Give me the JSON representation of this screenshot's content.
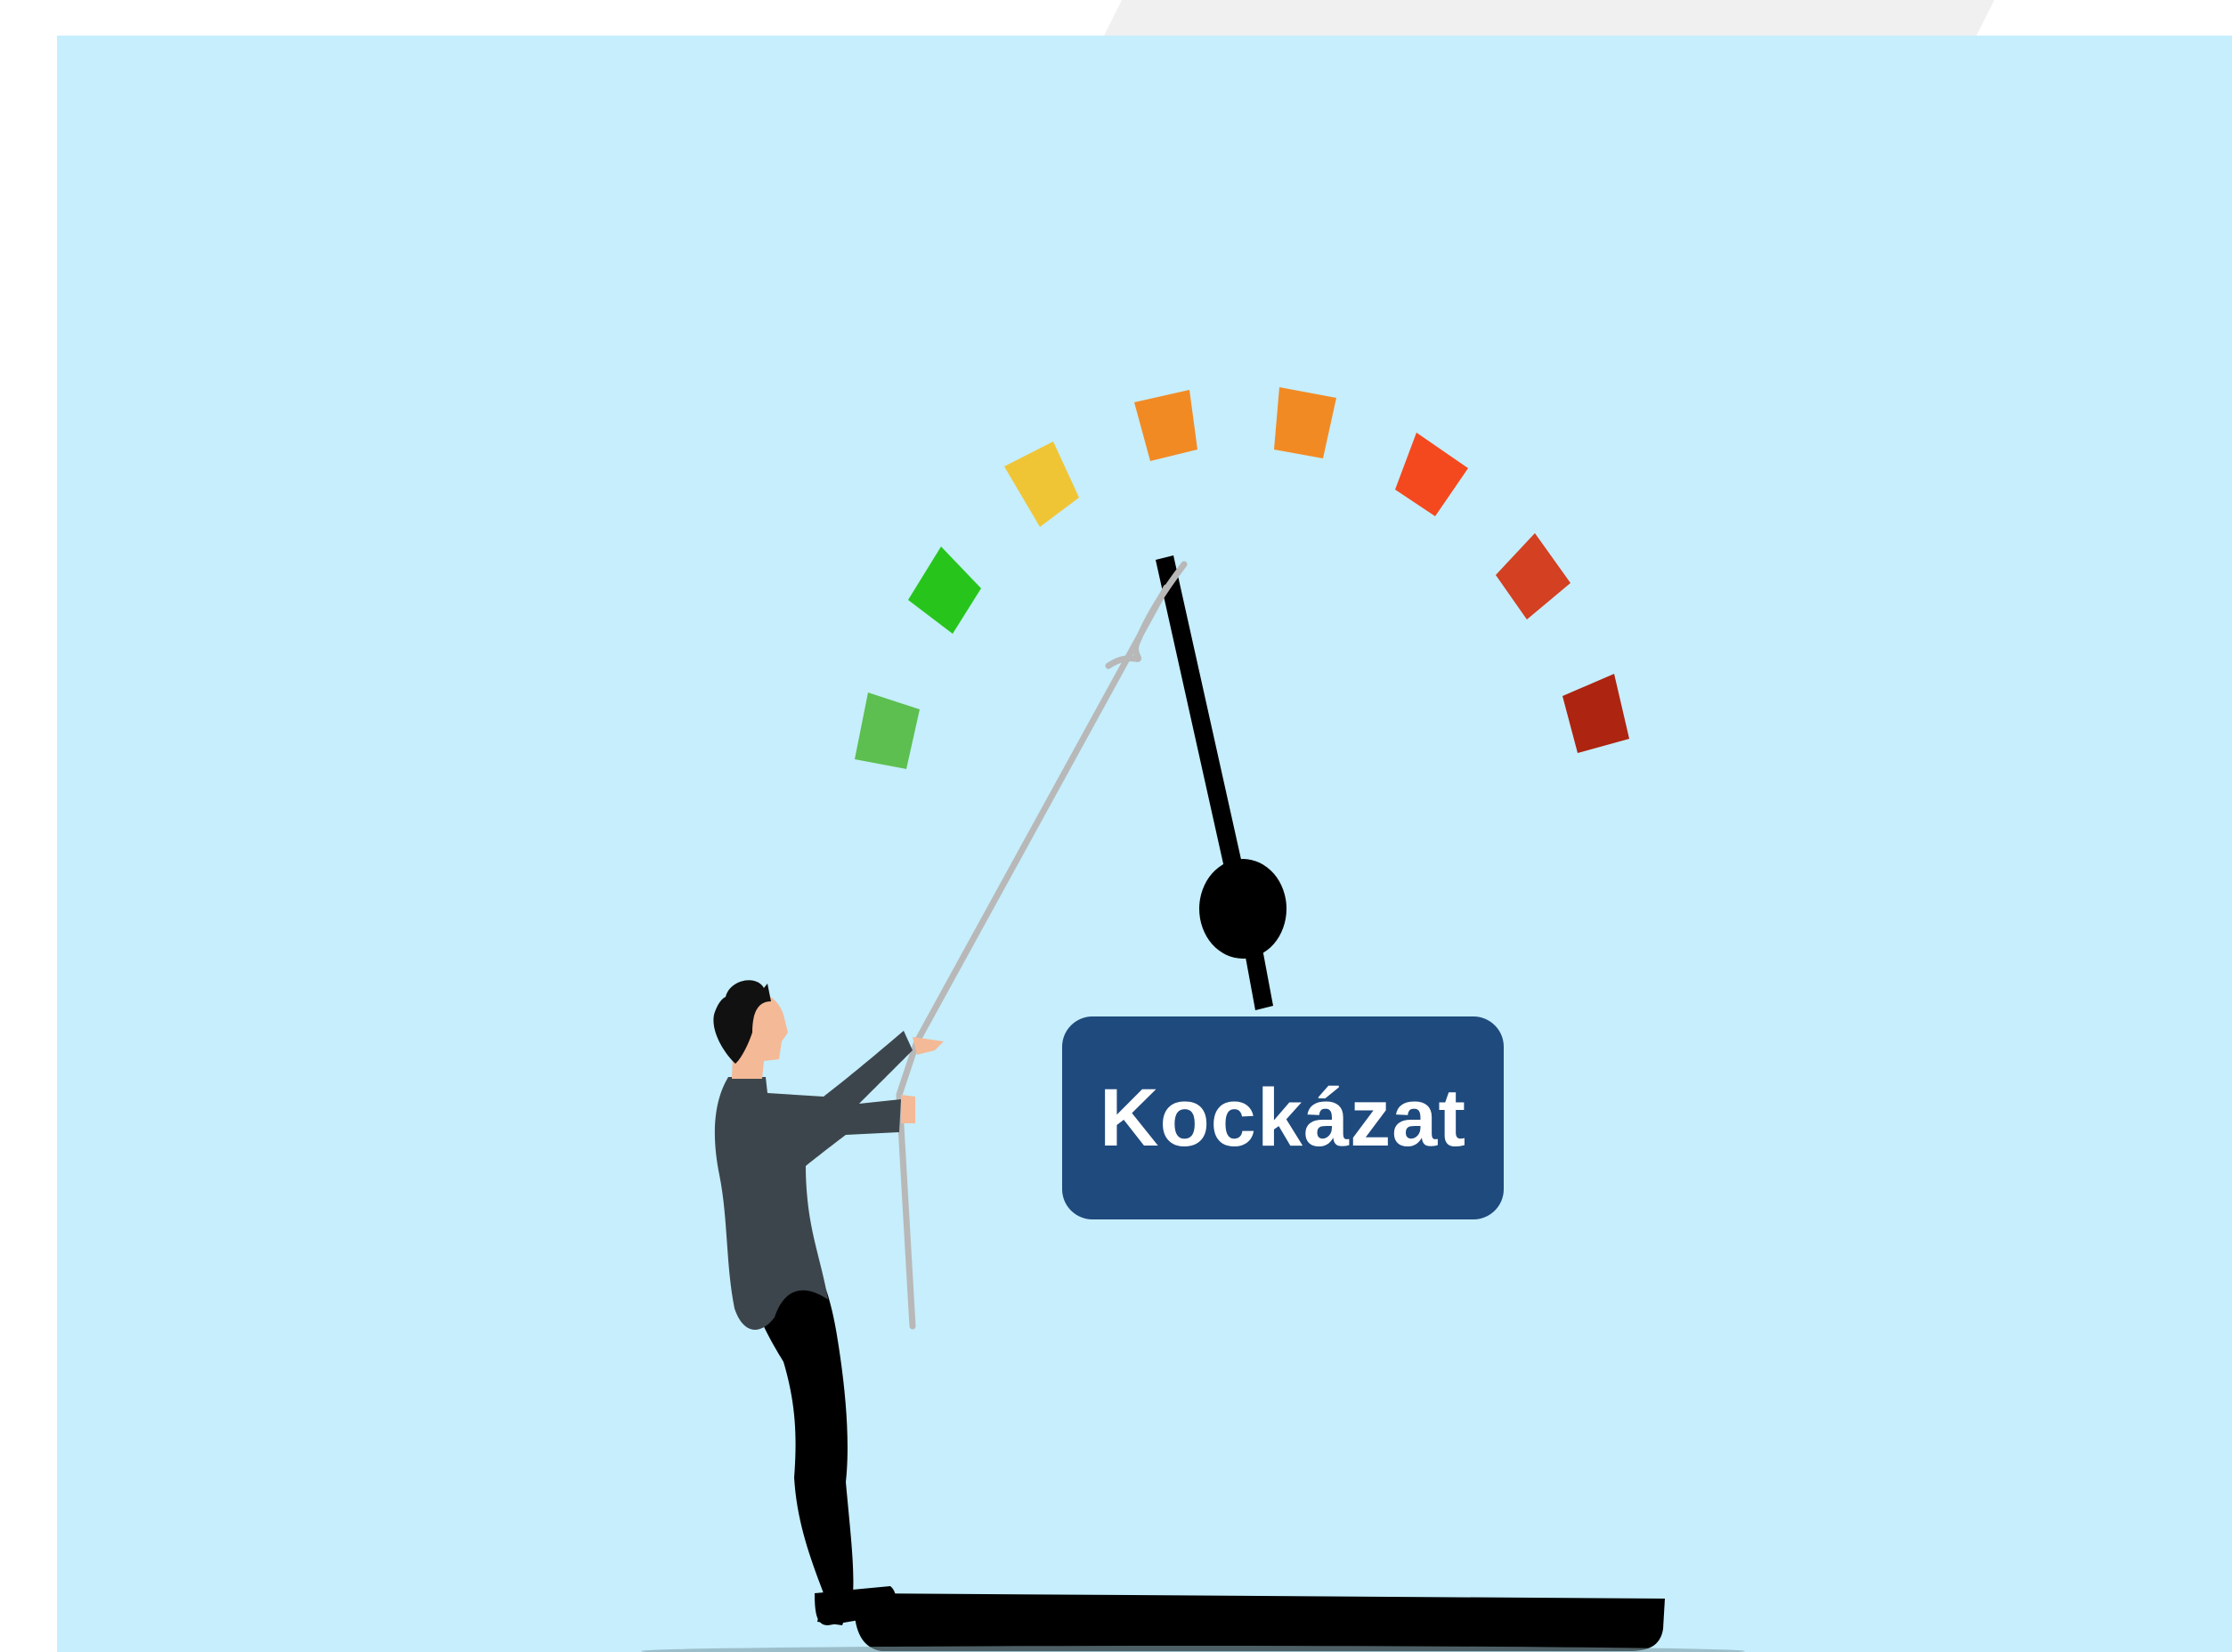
{
  "label": {
    "text": "Kockázat"
  },
  "gauge": {
    "segment_colors": [
      "#5cbf50",
      "#27c51c",
      "#f0c535",
      "#f28a24",
      "#f28a24",
      "#f4491f",
      "#d34022",
      "#ad2410"
    ],
    "needle_color": "#000000"
  },
  "figure": {
    "suit_color": "#3d454c",
    "skin_color": "#f4b996",
    "hair_color": "#111111",
    "rope_color": "#b8b8b8"
  },
  "background": {
    "sky_color": "#c6eefc"
  }
}
